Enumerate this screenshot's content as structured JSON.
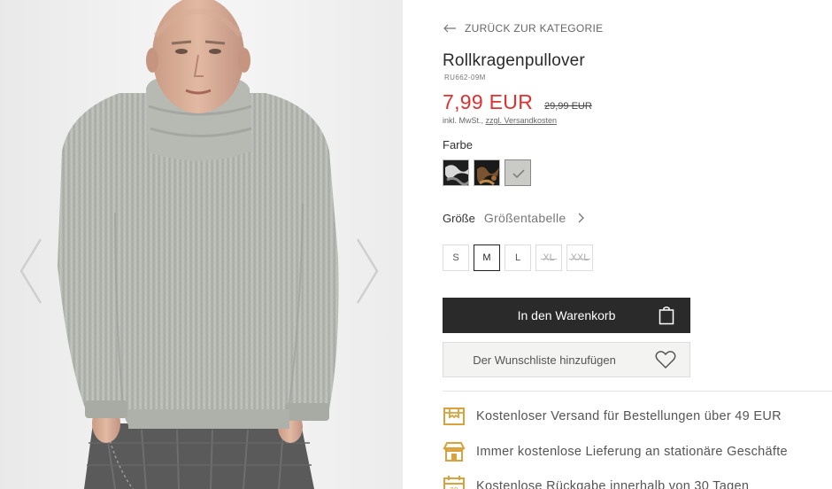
{
  "gallery": {
    "prev_icon": "chevron-left-icon",
    "next_icon": "chevron-right-icon"
  },
  "product": {
    "back_label": "ZURÜCK ZUR KATEGORIE",
    "title": "Rollkragenpullover",
    "sku": "RU662-09M",
    "price": "7,99 EUR",
    "old_price": "29,99 EUR",
    "vat_text": "inkl. MwSt., ",
    "shipping_link": "zzgl. Versandkosten",
    "color_label": "Farbe",
    "colors": [
      {
        "name": "black-camo",
        "color": "#2a2a2a"
      },
      {
        "name": "brown-camo",
        "color": "#6b4a2a"
      },
      {
        "name": "light-grey",
        "color": "#c8c8c4",
        "selected": true
      }
    ],
    "size_label": "Größe",
    "size_chart_label": "Größentabelle",
    "sizes": [
      {
        "label": "S",
        "state": "available"
      },
      {
        "label": "M",
        "state": "selected"
      },
      {
        "label": "L",
        "state": "available"
      },
      {
        "label": "XL",
        "state": "unavailable"
      },
      {
        "label": "XXL",
        "state": "unavailable"
      }
    ],
    "cart_label": "In den Warenkorb",
    "wishlist_label": "Der Wunschliste hinzufügen"
  },
  "benefits": [
    {
      "icon": "delivery-box-icon",
      "text": "Kostenloser Versand für Bestellungen über 49 EUR"
    },
    {
      "icon": "store-icon",
      "text": "Immer kostenlose Lieferung an stationäre Geschäfte"
    },
    {
      "icon": "calendar-return-icon",
      "text": "Kostenlose Rückgabe innerhalb von 30 Tagen"
    }
  ],
  "colors": {
    "accent_price": "#e03030",
    "icon_gold": "#d9a23c",
    "cart_bg": "#2a2a2a"
  }
}
